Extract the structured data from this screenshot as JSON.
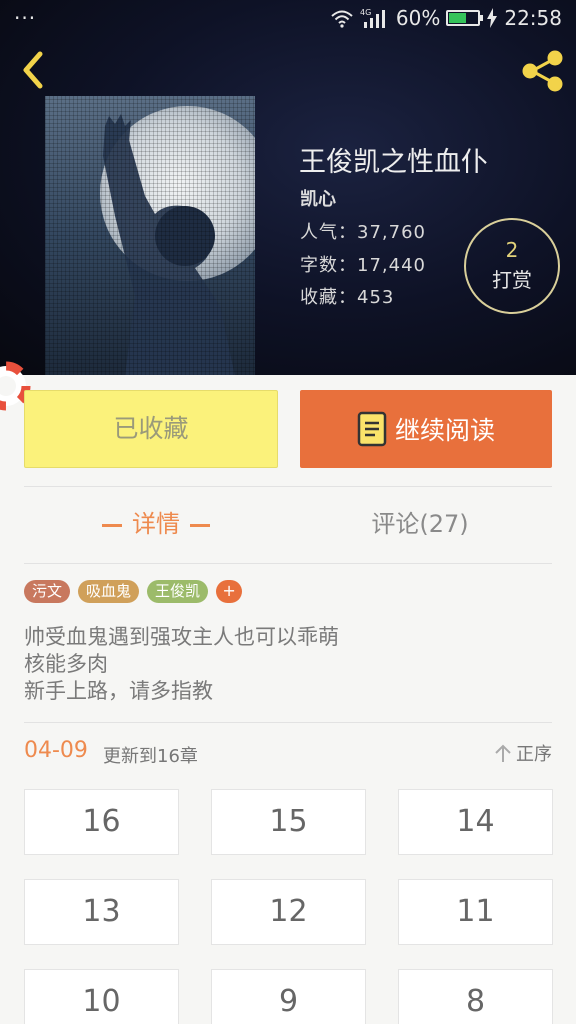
{
  "status_bar": {
    "dots": "···",
    "signal_label": "4G",
    "battery_percent": "60%",
    "battery_level": 0.6,
    "time": "22:58"
  },
  "book": {
    "title": "王俊凯之性血仆",
    "author": "凯心",
    "popularity": "人气：37,760",
    "word_count": "字数：17,440",
    "favorites": "收藏：453"
  },
  "tip": {
    "count": "2",
    "label": "打赏"
  },
  "actions": {
    "favorited_label": "已收藏",
    "continue_label": "继续阅读"
  },
  "tabs": {
    "detail": "详情",
    "comments": "评论(27)"
  },
  "tags": [
    {
      "label": "污文",
      "color": "#c8785e"
    },
    {
      "label": "吸血鬼",
      "color": "#d0a05a"
    },
    {
      "label": "王俊凯",
      "color": "#9cbb6a"
    }
  ],
  "tag_add": "+",
  "description": [
    "帅受血鬼遇到强攻主人也可以乖萌",
    "核能多肉",
    "新手上路，请多指教"
  ],
  "update": {
    "date": "04-09",
    "text": "更新到16章",
    "sort_label": "正序"
  },
  "chapters": [
    "16",
    "15",
    "14",
    "13",
    "12",
    "11",
    "10",
    "9",
    "8"
  ],
  "colors": {
    "accent_orange": "#e8703c",
    "favorite_yellow": "#fbf27b",
    "tip_gold": "#e2d27a"
  },
  "icons": {
    "back": "chevron-left-icon",
    "share": "share-icon",
    "book": "book-icon",
    "sort": "arrow-up-icon",
    "lifebuoy": "lifebuoy-icon"
  }
}
